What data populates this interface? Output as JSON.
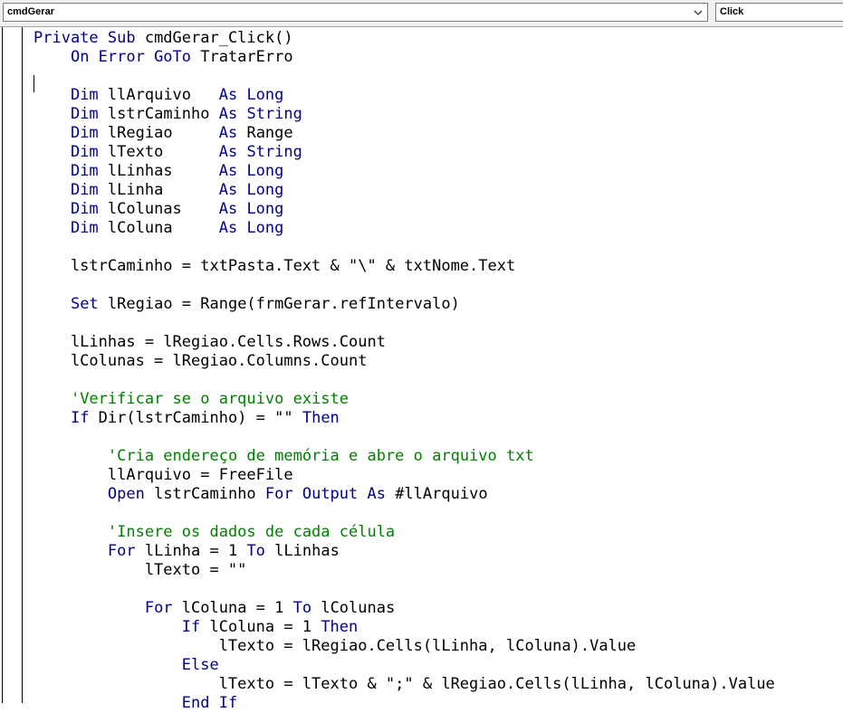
{
  "toolbar": {
    "object_combo": "cmdGerar",
    "procedure_combo": "Click",
    "object_arrow_icon": "chevron-down-icon"
  },
  "code_lines": [
    [
      {
        "t": "Private Sub",
        "c": "kw"
      },
      {
        "t": " cmdGerar_Click()",
        "c": ""
      }
    ],
    [
      {
        "t": "    ",
        "c": ""
      },
      {
        "t": "On Error GoTo",
        "c": "kw"
      },
      {
        "t": " TratarErro",
        "c": ""
      }
    ],
    [],
    [
      {
        "t": "    ",
        "c": ""
      },
      {
        "t": "Dim",
        "c": "kw"
      },
      {
        "t": " llArquivo   ",
        "c": ""
      },
      {
        "t": "As Long",
        "c": "kw"
      }
    ],
    [
      {
        "t": "    ",
        "c": ""
      },
      {
        "t": "Dim",
        "c": "kw"
      },
      {
        "t": " lstrCaminho ",
        "c": ""
      },
      {
        "t": "As String",
        "c": "kw"
      }
    ],
    [
      {
        "t": "    ",
        "c": ""
      },
      {
        "t": "Dim",
        "c": "kw"
      },
      {
        "t": " lRegiao     ",
        "c": ""
      },
      {
        "t": "As",
        "c": "kw"
      },
      {
        "t": " Range",
        "c": ""
      }
    ],
    [
      {
        "t": "    ",
        "c": ""
      },
      {
        "t": "Dim",
        "c": "kw"
      },
      {
        "t": " lTexto      ",
        "c": ""
      },
      {
        "t": "As String",
        "c": "kw"
      }
    ],
    [
      {
        "t": "    ",
        "c": ""
      },
      {
        "t": "Dim",
        "c": "kw"
      },
      {
        "t": " lLinhas     ",
        "c": ""
      },
      {
        "t": "As Long",
        "c": "kw"
      }
    ],
    [
      {
        "t": "    ",
        "c": ""
      },
      {
        "t": "Dim",
        "c": "kw"
      },
      {
        "t": " lLinha      ",
        "c": ""
      },
      {
        "t": "As Long",
        "c": "kw"
      }
    ],
    [
      {
        "t": "    ",
        "c": ""
      },
      {
        "t": "Dim",
        "c": "kw"
      },
      {
        "t": " lColunas    ",
        "c": ""
      },
      {
        "t": "As Long",
        "c": "kw"
      }
    ],
    [
      {
        "t": "    ",
        "c": ""
      },
      {
        "t": "Dim",
        "c": "kw"
      },
      {
        "t": " lColuna     ",
        "c": ""
      },
      {
        "t": "As Long",
        "c": "kw"
      }
    ],
    [],
    [
      {
        "t": "    lstrCaminho = txtPasta.Text & \"\\\" & txtNome.Text",
        "c": ""
      }
    ],
    [],
    [
      {
        "t": "    ",
        "c": ""
      },
      {
        "t": "Set",
        "c": "kw"
      },
      {
        "t": " lRegiao = Range(frmGerar.refIntervalo)",
        "c": ""
      }
    ],
    [],
    [
      {
        "t": "    lLinhas = lRegiao.Cells.Rows.Count",
        "c": ""
      }
    ],
    [
      {
        "t": "    lColunas = lRegiao.Columns.Count",
        "c": ""
      }
    ],
    [],
    [
      {
        "t": "    ",
        "c": ""
      },
      {
        "t": "'Verificar se o arquivo existe",
        "c": "cm"
      }
    ],
    [
      {
        "t": "    ",
        "c": ""
      },
      {
        "t": "If",
        "c": "kw"
      },
      {
        "t": " Dir(lstrCaminho) = \"\" ",
        "c": ""
      },
      {
        "t": "Then",
        "c": "kw"
      }
    ],
    [],
    [
      {
        "t": "        ",
        "c": ""
      },
      {
        "t": "'Cria endereço de memória e abre o arquivo txt",
        "c": "cm"
      }
    ],
    [
      {
        "t": "        llArquivo = FreeFile",
        "c": ""
      }
    ],
    [
      {
        "t": "        ",
        "c": ""
      },
      {
        "t": "Open",
        "c": "kw"
      },
      {
        "t": " lstrCaminho ",
        "c": ""
      },
      {
        "t": "For Output As",
        "c": "kw"
      },
      {
        "t": " #llArquivo",
        "c": ""
      }
    ],
    [],
    [
      {
        "t": "        ",
        "c": ""
      },
      {
        "t": "'Insere os dados de cada célula",
        "c": "cm"
      }
    ],
    [
      {
        "t": "        ",
        "c": ""
      },
      {
        "t": "For",
        "c": "kw"
      },
      {
        "t": " lLinha = 1 ",
        "c": ""
      },
      {
        "t": "To",
        "c": "kw"
      },
      {
        "t": " lLinhas",
        "c": ""
      }
    ],
    [
      {
        "t": "            lTexto = \"\"",
        "c": ""
      }
    ],
    [],
    [
      {
        "t": "            ",
        "c": ""
      },
      {
        "t": "For",
        "c": "kw"
      },
      {
        "t": " lColuna = 1 ",
        "c": ""
      },
      {
        "t": "To",
        "c": "kw"
      },
      {
        "t": " lColunas",
        "c": ""
      }
    ],
    [
      {
        "t": "                ",
        "c": ""
      },
      {
        "t": "If",
        "c": "kw"
      },
      {
        "t": " lColuna = 1 ",
        "c": ""
      },
      {
        "t": "Then",
        "c": "kw"
      }
    ],
    [
      {
        "t": "                    lTexto = lRegiao.Cells(lLinha, lColuna).Value",
        "c": ""
      }
    ],
    [
      {
        "t": "                ",
        "c": ""
      },
      {
        "t": "Else",
        "c": "kw"
      }
    ],
    [
      {
        "t": "                    lTexto = lTexto & \";\" & lRegiao.Cells(lLinha, lColuna).Value",
        "c": ""
      }
    ],
    [
      {
        "t": "                ",
        "c": ""
      },
      {
        "t": "End If",
        "c": "kw"
      }
    ]
  ],
  "colors": {
    "keyword": "#00008b",
    "comment": "#008000",
    "text": "#000000"
  }
}
